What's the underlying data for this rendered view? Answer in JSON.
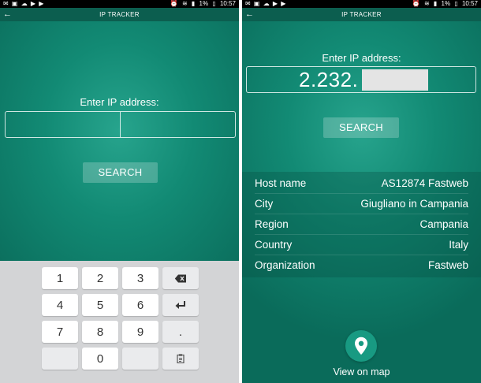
{
  "status_bar": {
    "battery": "1%",
    "time": "10:57"
  },
  "left": {
    "app_title": "IP TRACKER",
    "prompt": "Enter IP address:",
    "search_label": "SEARCH",
    "keyboard": {
      "rows": [
        [
          "1",
          "2",
          "3",
          "backspace-icon"
        ],
        [
          "4",
          "5",
          "6",
          "enter-icon"
        ],
        [
          "7",
          "8",
          "9",
          "."
        ],
        [
          "",
          "0",
          "",
          "clipboard-icon"
        ]
      ]
    }
  },
  "right": {
    "app_title": "IP TRACKER",
    "prompt": "Enter IP address:",
    "ip_value": "2.232.",
    "search_label": "SEARCH",
    "results": [
      {
        "label": "Host name",
        "value": "AS12874 Fastweb"
      },
      {
        "label": "City",
        "value": "Giugliano in Campania"
      },
      {
        "label": "Region",
        "value": "Campania"
      },
      {
        "label": "Country",
        "value": "Italy"
      },
      {
        "label": "Organization",
        "value": "Fastweb"
      }
    ],
    "map_label": "View on map"
  }
}
